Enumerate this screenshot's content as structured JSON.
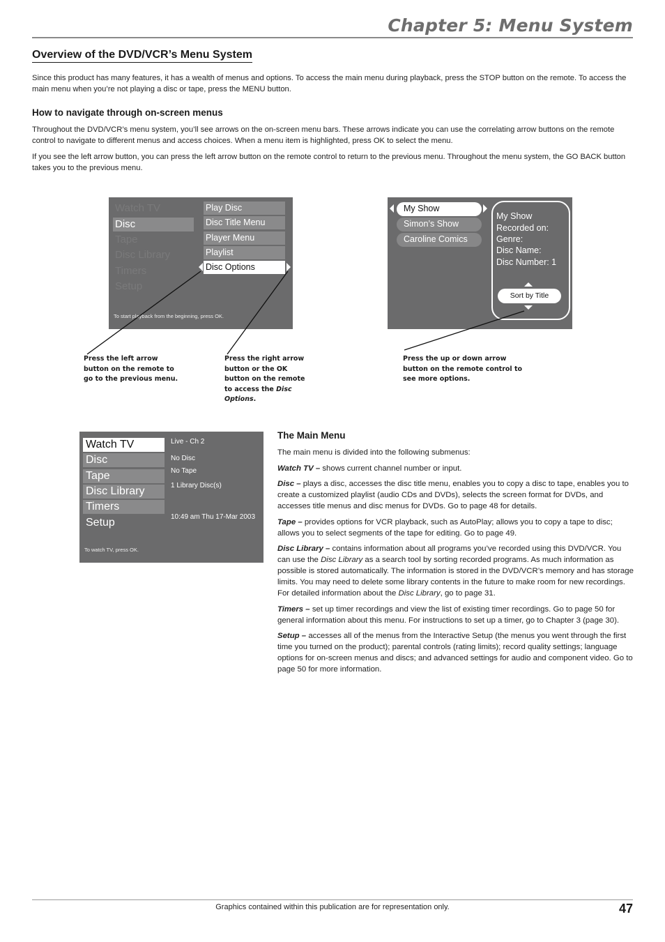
{
  "header": {
    "chapter_title": "Chapter 5: Menu System",
    "section_title": "Overview of the DVD/VCR’s Menu System"
  },
  "intro": {
    "paragraph": "Since this product has many features, it has a wealth of menus and options. To access the main menu during playback, press the STOP button on the remote. To access the main menu when you’re not playing a disc or tape, press the MENU button."
  },
  "navigate": {
    "title": "How to navigate through on-screen menus",
    "paragraphs": [
      "Throughout the DVD/VCR’s menu system, you’ll see arrows on the on-screen menu bars. These arrows indicate you can use the correlating arrow buttons on the remote control to navigate to different menus and access choices. When a menu item is highlighted, press OK to select the menu.",
      "If you see the left arrow button, you can press the left arrow button on the remote control to return to the previous menu. Throughout the menu system, the GO BACK button takes you to the previous menu."
    ]
  },
  "screen_disc": {
    "main_items": [
      "Watch TV",
      "Disc",
      "Tape",
      "Disc Library",
      "Timers",
      "Setup"
    ],
    "active_main": "Disc",
    "sub_items": [
      "Play Disc",
      "Disc Title Menu",
      "Player Menu",
      "Playlist",
      "Disc Options"
    ],
    "active_sub": "Disc Options",
    "hint": "To start playback from the beginning, press OK."
  },
  "screen_library": {
    "titles": [
      "My Show",
      "Simon’s Show",
      "Caroline Comics"
    ],
    "active_title": "My Show",
    "info_lines": [
      "My Show",
      "Recorded on:",
      "Genre:",
      "Disc Name:",
      "Disc Number: 1"
    ],
    "sort_button": "Sort by Title"
  },
  "callouts": {
    "left_arrow": "Press the left arrow button on the remote to go to the previous menu.",
    "right_arrow_prefix": "Press the right arrow button or the OK button on the remote to access the ",
    "right_arrow_italic": "Disc Options",
    "right_arrow_suffix": ".",
    "up_down": "Press the up or down arrow button on the remote control to see more options."
  },
  "screen_main": {
    "items": [
      "Watch TV",
      "Disc",
      "Tape",
      "Disc Library",
      "Timers",
      "Setup"
    ],
    "active_item": "Watch TV",
    "info": {
      "channel": "Live - Ch 2",
      "disc": "No Disc",
      "tape": "No Tape",
      "library": "1 Library Disc(s)",
      "datetime": "10:49 am Thu 17-Mar 2003"
    },
    "hint": "To watch TV, press OK."
  },
  "main_menu": {
    "title": "The Main Menu",
    "intro": "The main menu is divided into the following submenus:",
    "entries": [
      {
        "term": "Watch TV –",
        "text": " shows current channel number or input."
      },
      {
        "term": "Disc –",
        "text": " plays a disc, accesses the disc title menu, enables you to copy a disc to tape, enables you to create a customized playlist (audio CDs and DVDs), selects the screen format for DVDs, and accesses title menus and disc menus for DVDs. Go to page 48 for details."
      },
      {
        "term": "Tape –",
        "text": " provides options for VCR playback, such as AutoPlay; allows you to copy a tape to disc; allows you to select segments of the tape for editing. Go to page 49."
      },
      {
        "term": "Disc Library –",
        "text_1": " contains information about all programs you’ve recorded using this DVD/VCR. You can use the ",
        "italic_1": "Disc Library",
        "text_2": " as a search tool by sorting recorded programs. As much information as possible is stored automatically. The information is stored in the DVD/VCR’s memory and has storage limits. You may need to delete some library contents in the future to make room for new recordings. For detailed information about the ",
        "italic_2": "Disc Library",
        "text_3": ", go to page 31."
      },
      {
        "term": "Timers –",
        "text": " set up timer recordings and view the list of existing timer recordings. Go to page 50 for general information about this menu. For instructions to set up a timer, go to Chapter 3 (page 30)."
      },
      {
        "term": "Setup –",
        "text": " accesses all of the menus from the Interactive Setup (the menus you went through the first time you turned on the product); parental controls (rating limits); record quality settings; language options for on-screen menus and discs; and advanced settings for audio and component video. Go to page 50 for more information."
      }
    ]
  },
  "footer": {
    "note": "Graphics contained within this publication are for representation only.",
    "page_number": "47"
  }
}
